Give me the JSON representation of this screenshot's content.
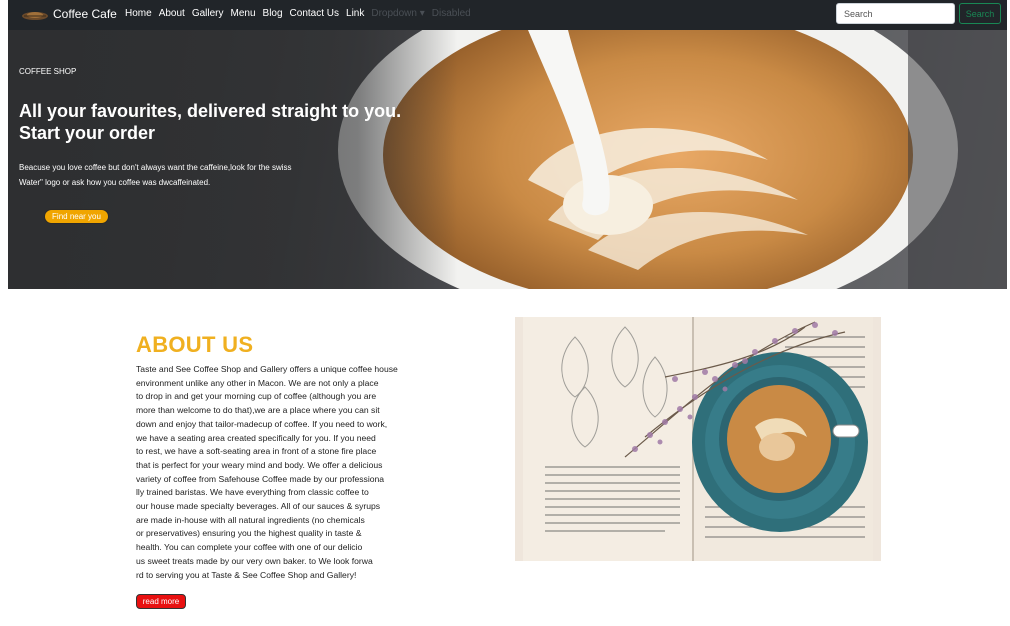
{
  "brand": {
    "name": "Coffee Cafe",
    "logo_icon": "coffee-logo-icon"
  },
  "nav": {
    "links": [
      {
        "label": "Home",
        "muted": false
      },
      {
        "label": "About",
        "muted": false
      },
      {
        "label": "Gallery",
        "muted": false
      },
      {
        "label": "Menu",
        "muted": false
      },
      {
        "label": "Blog",
        "muted": false
      },
      {
        "label": "Contact Us",
        "muted": false
      },
      {
        "label": "Link",
        "muted": false
      },
      {
        "label": "Dropdown",
        "muted": true
      },
      {
        "label": "Disabled",
        "muted": true
      }
    ]
  },
  "search": {
    "placeholder": "Search",
    "button_label": "Search"
  },
  "hero": {
    "tag": "COFFEE SHOP",
    "title_line1": "All your favourites, delivered straight to you.",
    "title_line2": "Start your order",
    "desc_line1": "Beacuse you love coffee but don't always want the caffeine,look for the swiss",
    "desc_line2": "Water\" logo or ask how you coffee was dwcaffeinated.",
    "cta_label": "Find near you"
  },
  "about": {
    "heading": "ABOUT US",
    "lines": [
      "Taste and See Coffee Shop and Gallery offers a unique coffee house",
      "environment unlike any other in Macon. We are not only a place",
      "to drop in and get your morning cup of coffee (although you are",
      "more than welcome to do that),we are a place where you can sit",
      "down and enjoy that tailor-madecup of coffee. If you need to work,",
      "we have a seating area created specifically for you. If you need",
      "to rest, we have a soft-seating area in front of a stone fire place",
      "that is perfect for your weary mind and body. We offer a delicious",
      "variety of coffee from Safehouse Coffee made by our professiona",
      "lly trained baristas. We have everything from classic coffee to",
      "our house made specialty beverages. All of our sauces & syrups",
      "are made in-house with all natural ingredients (no chemicals",
      "or preservatives) ensuring you the highest quality in taste &",
      "health. You can complete your coffee with one of our delicio",
      "us sweet treats made by our very own baker. to We look forwa",
      "rd to serving you at Taste & See Coffee Shop and Gallery!"
    ],
    "read_more_label": "read more"
  },
  "colors": {
    "navbar": "#212529",
    "accent": "#f0b020",
    "cta": "#f0a500",
    "read_more": "#e81010",
    "search_button": "#198754"
  }
}
